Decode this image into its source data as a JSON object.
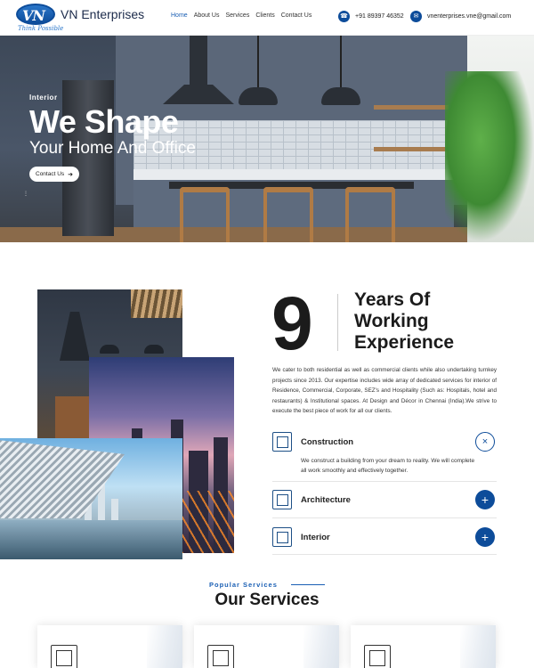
{
  "header": {
    "logo_mark": "VN",
    "brand": "VN Enterprises",
    "tagline": "Think Possible",
    "nav": [
      "Home",
      "About Us",
      "Services",
      "Clients",
      "Contact Us"
    ],
    "phone": "+91 89397 46352",
    "email": "vnenterprises.vne@gmail.com",
    "accent": "#0d4c9a"
  },
  "hero": {
    "kicker": "Interior",
    "title": "We Shape",
    "subtitle": "Your Home And Office",
    "cta": "Contact Us"
  },
  "about": {
    "years_number": "9",
    "years_label_1": "Years Of",
    "years_label_2": "Working",
    "years_label_3": "Experience",
    "paragraph": "We cater to both residential as well as commercial clients while also undertaking turnkey projects since 2013. Our expertise includes wide array of dedicated services for interior of Residence, Commercial, Corporate, SEZ's and Hospitality (Such as: Hospitals, hotel and restaurants) & Institutional spaces. At Design and Décor in Chennai (India).We strive to execute the best piece of work for all our clients.",
    "accordion": [
      {
        "title": "Construction",
        "state": "open",
        "icon": "crane-icon",
        "body": "We construct a building from your dream to reality. We will complete all work smoothly and effectively together.",
        "button": "×"
      },
      {
        "title": "Architecture",
        "state": "closed",
        "icon": "blueprint-icon",
        "button": "+"
      },
      {
        "title": "Interior",
        "state": "closed",
        "icon": "interior-icon",
        "button": "+"
      }
    ]
  },
  "services": {
    "kicker": "Popular Services",
    "title": "Our Services"
  }
}
